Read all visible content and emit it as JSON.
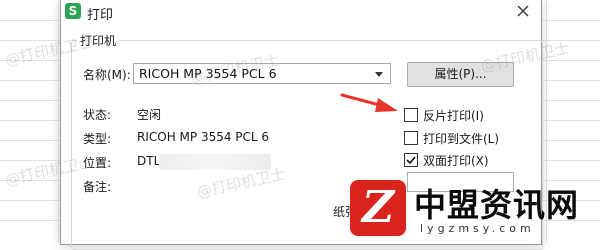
{
  "dialog": {
    "title": "打印",
    "app_icon_letter": "S",
    "close_icon": "close-icon"
  },
  "printer_group": {
    "label": "打印机",
    "name_label": "名称(M):",
    "selected_printer": "RICOH MP 3554 PCL 6",
    "properties_button": "属性(P)...",
    "status_label": "状态:",
    "status_value": "空闲",
    "type_label": "类型:",
    "type_value": "RICOH MP 3554 PCL 6",
    "location_label": "位置:",
    "location_value": "DTL_",
    "comment_label": "备注:",
    "paper_label": "纸张"
  },
  "options": [
    {
      "label": "反片打印(I)",
      "checked": false
    },
    {
      "label": "打印到文件(L)",
      "checked": false
    },
    {
      "label": "双面打印(X)",
      "checked": true
    }
  ],
  "watermarks": [
    "@打印机卫士",
    "@打印机卫士",
    "@打印机卫士",
    "@打印机卫士",
    "@打印机卫士"
  ],
  "overlay": {
    "logo_letter": "Z",
    "site_name": "中盟资讯网",
    "site_url": "lygzmsy.com",
    "arrow_color": "#e8342a"
  }
}
